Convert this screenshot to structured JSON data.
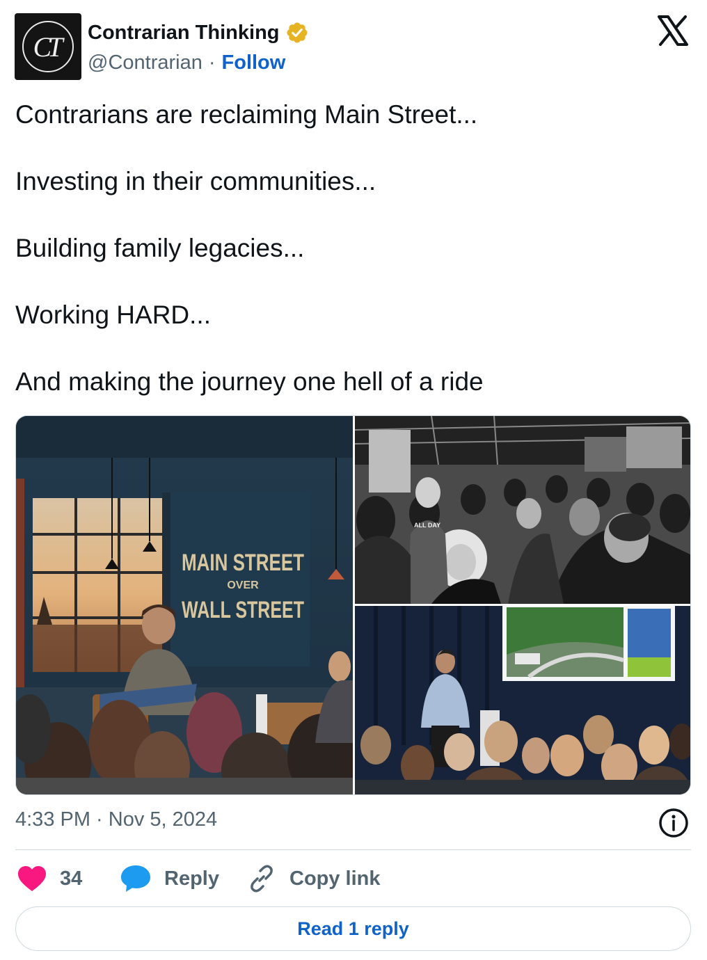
{
  "author": {
    "display_name": "Contrarian Thinking",
    "handle": "@Contrarian",
    "separator": "·",
    "follow_label": "Follow",
    "avatar_initials": "CT",
    "verified_color": "#e6b422"
  },
  "tweet": {
    "lines": [
      "Contrarians are reclaiming Main Street...",
      "Investing in their communities...",
      "Building family legacies...",
      "Working HARD...",
      "And making the journey one hell of a ride"
    ]
  },
  "media": {
    "photo1_sign": {
      "line1": "MAIN STREET",
      "line2": "OVER",
      "line3": "WALL STREET"
    },
    "photo2_shirt_text": "ALL DAY"
  },
  "meta": {
    "timestamp": "4:33 PM · Nov 5, 2024"
  },
  "actions": {
    "like_count": "34",
    "reply_label": "Reply",
    "copy_link_label": "Copy link",
    "read_replies_label": "Read 1 reply"
  },
  "colors": {
    "link_blue": "#0f62c9",
    "like_pink": "#f91880",
    "reply_blue": "#1d9bf0",
    "secondary_text": "#536471",
    "border": "#cfd9de"
  },
  "icons": {
    "brand": "x-logo-icon",
    "verified": "verified-badge-icon",
    "info": "info-icon",
    "like": "heart-icon",
    "reply": "speech-bubble-icon",
    "copy": "link-icon"
  }
}
